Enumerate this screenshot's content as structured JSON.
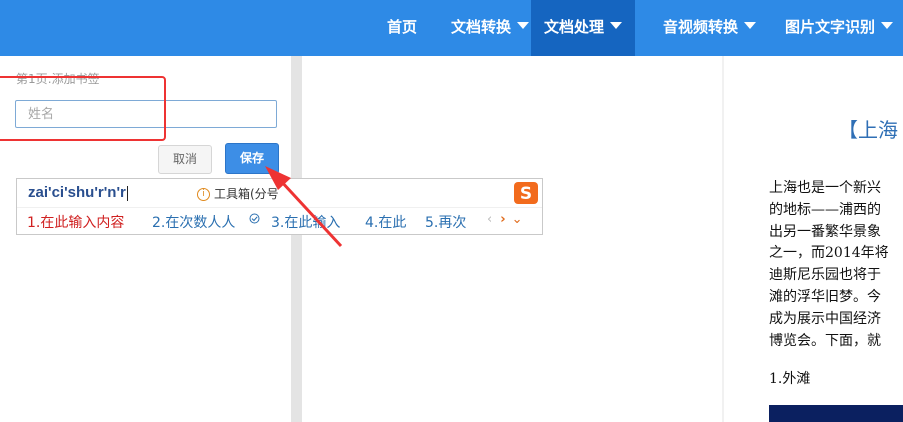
{
  "nav": {
    "items": [
      {
        "label": "首页",
        "dropdown": false,
        "active": false
      },
      {
        "label": "文档转换",
        "dropdown": true,
        "active": false
      },
      {
        "label": "文档处理",
        "dropdown": true,
        "active": true
      },
      {
        "label": "音视频转换",
        "dropdown": true,
        "active": false
      },
      {
        "label": "图片文字识别",
        "dropdown": true,
        "active": false
      }
    ]
  },
  "form": {
    "page_label": "第1页:添加书签",
    "name_placeholder": "姓名",
    "cancel_label": "取消",
    "save_label": "保存"
  },
  "ime": {
    "typed": "zai'ci'shu'r'n'r",
    "info_label": "工具箱(分号",
    "candidates": [
      "1.在此输入内容",
      "2.在次数人人",
      "3.在此输入",
      "4.在此",
      "5.再次"
    ],
    "nav_prev": "‹",
    "nav_next": "›",
    "nav_expand": "⌄"
  },
  "document": {
    "title": "【上海",
    "paragraph_lines": [
      "上海也是一个新兴",
      "的地标——浦西的",
      "出另一番繁华景象",
      "之一，而2014年将",
      "迪斯尼乐园也将于",
      "滩的浮华旧梦。今",
      "成为展示中国经济",
      "博览会。下面，就"
    ],
    "section_heading": "1.外滩"
  },
  "colors": {
    "topbar": "#2e8ae6",
    "nav_active": "#1565c0",
    "annotation_red": "#e33333",
    "save_button": "#3d8ee6",
    "candidate_first": "#d02020",
    "candidate": "#2a6fb0"
  }
}
